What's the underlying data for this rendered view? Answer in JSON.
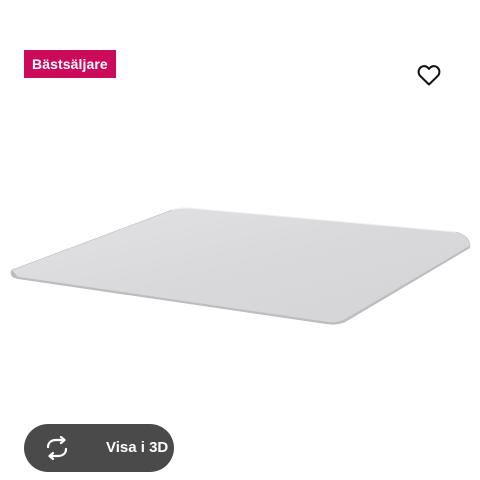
{
  "badge": {
    "label": "Bästsäljare",
    "color": "#cc0a5c"
  },
  "favorite": {
    "icon": "heart-outline-icon"
  },
  "product_image": {
    "subject": "floor protector mat"
  },
  "view_3d": {
    "label": "Visa i 3D",
    "icon": "rotate-3d-icon",
    "background": "#4a4a4a"
  }
}
